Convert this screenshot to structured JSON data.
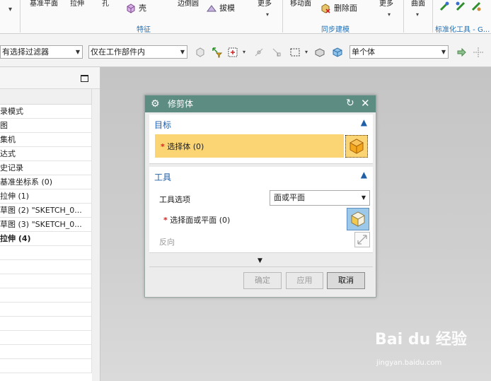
{
  "ribbon": {
    "features_row": {
      "datum_plane": "基准平面",
      "extrude": "拉伸",
      "hole": "孔",
      "shell": "壳",
      "edge_blend": "边倒圆",
      "draft": "拔模",
      "more": "更多"
    },
    "sync_row": {
      "move_face": "移动面",
      "delete_face": "删除面",
      "more": "更多"
    },
    "surface": "曲面",
    "group_feature": "特征",
    "group_sync": "同步建模",
    "group_std_tools": "标准化工具 - G..."
  },
  "selection_bar": {
    "filter_value": "有选择过滤器",
    "scope_value": "仅在工作部件内",
    "body_type_value": "单个体"
  },
  "navigator": {
    "rows": [
      "录模式",
      "图",
      "集机",
      "达式",
      "史记录",
      "基准坐标系 (0)",
      "拉伸 (1)",
      "草图 (2) \"SKETCH_0...",
      "草图 (3) \"SKETCH_0...",
      "拉伸 (4)"
    ]
  },
  "dialog": {
    "title": "修剪体",
    "target_section": "目标",
    "select_body": "选择体 (0)",
    "tool_section": "工具",
    "tool_option_label": "工具选项",
    "tool_option_value": "面或平面",
    "select_face": "选择面或平面 (0)",
    "reverse": "反向",
    "ok": "确定",
    "apply": "应用",
    "cancel": "取消",
    "required_mark": "*"
  },
  "watermark": {
    "logo": "Bai du 经验",
    "url": "jingyan.baidu.com"
  },
  "colors": {
    "dialog_title_bg": "#5c8c82",
    "selection_highlight": "#fbd574",
    "section_header": "#1f5fa8",
    "ribbon_group_label": "#1f6fb5"
  }
}
